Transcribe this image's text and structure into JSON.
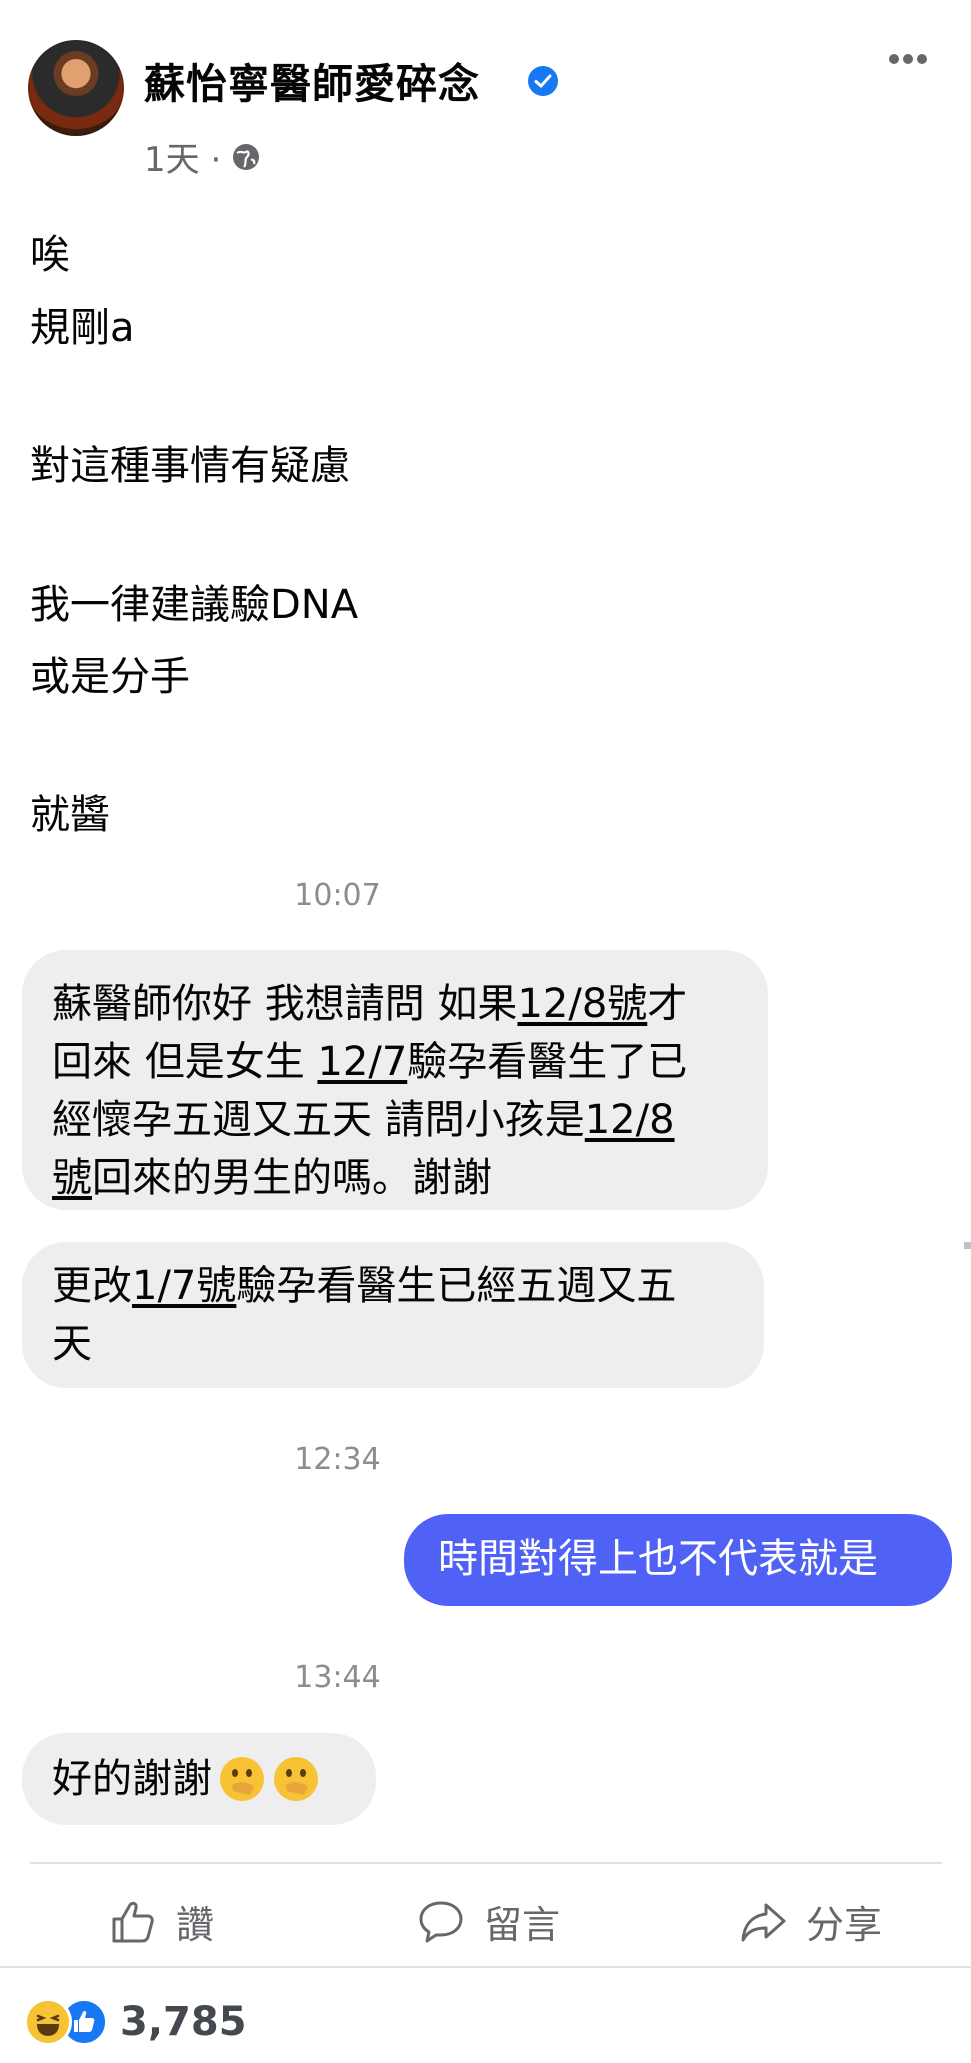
{
  "post": {
    "author": "蘇怡寧醫師愛碎念",
    "time": "1天 ·",
    "lines": [
      "唉",
      "規剛a",
      "對這種事情有疑慮",
      "我一律建議驗DNA",
      "或是分手",
      "就醬"
    ]
  },
  "chat": {
    "timestamps": [
      "10:07",
      "12:34",
      "13:44"
    ],
    "msg1": {
      "l1a": "蘇醫師你好 我想請問 如果",
      "l1u": "12/8號",
      "l1b": "才",
      "l2a": "回來 但是女生",
      "l2u": "12/7",
      "l2b": "驗孕看醫生了已",
      "l3a": "經懷孕五週又五天 請問小孩是",
      "l3u": "12/8",
      "l4u": "號",
      "l4b": "回來的男生的嗎。謝謝"
    },
    "msg2": {
      "l1a": "更改",
      "l1u": "1/7號",
      "l1b": "驗孕看醫生已經五週又五",
      "l2": "天"
    },
    "reply": "時間對得上也不代表就是",
    "msg3": "好的謝謝"
  },
  "actions": {
    "like": "讚",
    "comment": "留言",
    "share": "分享"
  },
  "reactions": {
    "count": "3,785"
  },
  "colors": {
    "out_bubble": "#4f62f5",
    "in_bubble": "#eeeef0",
    "verified": "#1877f2"
  }
}
